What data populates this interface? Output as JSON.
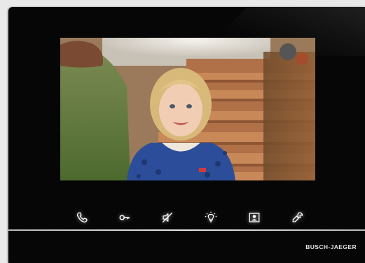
{
  "device": {
    "brand": "BUSCH-JAEGER"
  },
  "screen": {
    "content": "camera-feed"
  },
  "controls": [
    {
      "icon": "phone-icon"
    },
    {
      "icon": "key-icon"
    },
    {
      "icon": "mute-icon"
    },
    {
      "icon": "light-icon"
    },
    {
      "icon": "camera-switch-icon"
    },
    {
      "icon": "settings-wrench-icon"
    }
  ],
  "colors": {
    "bezel": "#060606",
    "icon_glow": "#ffffff",
    "divider": "#d8d8d8"
  }
}
